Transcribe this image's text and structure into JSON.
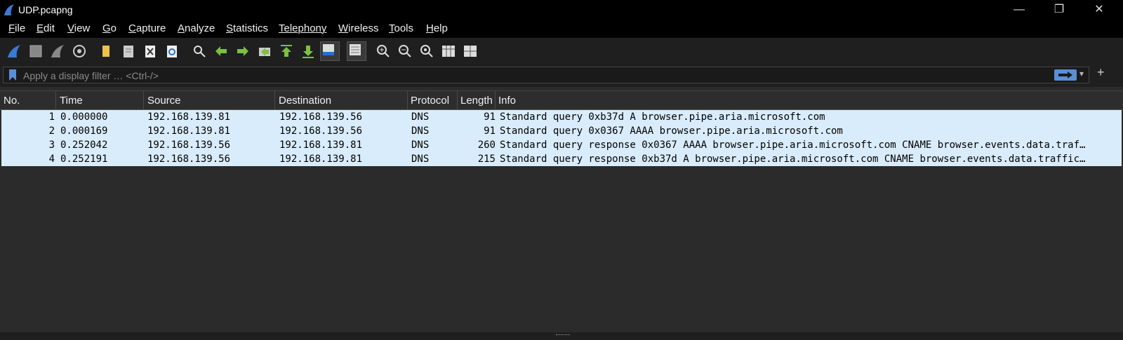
{
  "window": {
    "title": "UDP.pcapng",
    "minimize_glyph": "—",
    "restore_glyph": "❐",
    "close_glyph": "✕"
  },
  "menu": [
    {
      "first": "F",
      "rest": "ile"
    },
    {
      "first": "E",
      "rest": "dit"
    },
    {
      "first": "V",
      "rest": "iew"
    },
    {
      "first": "G",
      "rest": "o"
    },
    {
      "first": "C",
      "rest": "apture"
    },
    {
      "first": "A",
      "rest": "nalyze"
    },
    {
      "first": "S",
      "rest": "tatistics"
    },
    {
      "first": "",
      "rest": "Telephony",
      "underline_tail": "y"
    },
    {
      "first": "W",
      "rest": "ireless"
    },
    {
      "first": "T",
      "rest": "ools"
    },
    {
      "first": "H",
      "rest": "elp"
    }
  ],
  "toolbar": {
    "icons": [
      "shark-fin-start-icon",
      "stop-square-icon",
      "restart-fin-icon",
      "capture-options-gear-icon",
      "open-folder-icon",
      "file-icon",
      "close-file-icon",
      "reload-icon",
      "find-packet-icon",
      "go-back-arrow-icon",
      "go-forward-arrow-icon",
      "go-to-packet-icon",
      "first-packet-icon",
      "last-packet-icon",
      "autoscroll-icon",
      "colorize-icon",
      "zoom-in-icon",
      "zoom-out-icon",
      "zoom-normal-icon",
      "resize-columns-icon",
      "layout-panes-icon"
    ]
  },
  "filter": {
    "placeholder": "Apply a display filter … <Ctrl-/>",
    "plus": "+",
    "dropdown": "▾"
  },
  "columns": [
    "No.",
    "Time",
    "Source",
    "Destination",
    "Protocol",
    "Length",
    "Info"
  ],
  "packets": [
    {
      "no": "1",
      "time": "0.000000",
      "source": "192.168.139.81",
      "destination": "192.168.139.56",
      "protocol": "DNS",
      "length": "91",
      "info": "Standard query 0xb37d A browser.pipe.aria.microsoft.com"
    },
    {
      "no": "2",
      "time": "0.000169",
      "source": "192.168.139.81",
      "destination": "192.168.139.56",
      "protocol": "DNS",
      "length": "91",
      "info": "Standard query 0x0367 AAAA browser.pipe.aria.microsoft.com"
    },
    {
      "no": "3",
      "time": "0.252042",
      "source": "192.168.139.56",
      "destination": "192.168.139.81",
      "protocol": "DNS",
      "length": "260",
      "info": "Standard query response 0x0367 AAAA browser.pipe.aria.microsoft.com CNAME browser.events.data.traf…"
    },
    {
      "no": "4",
      "time": "0.252191",
      "source": "192.168.139.56",
      "destination": "192.168.139.81",
      "protocol": "DNS",
      "length": "215",
      "info": "Standard query response 0xb37d A browser.pipe.aria.microsoft.com CNAME browser.events.data.traffic…"
    }
  ],
  "colors": {
    "row_background": "#d9ecfb",
    "accent": "#5b8ed6"
  }
}
